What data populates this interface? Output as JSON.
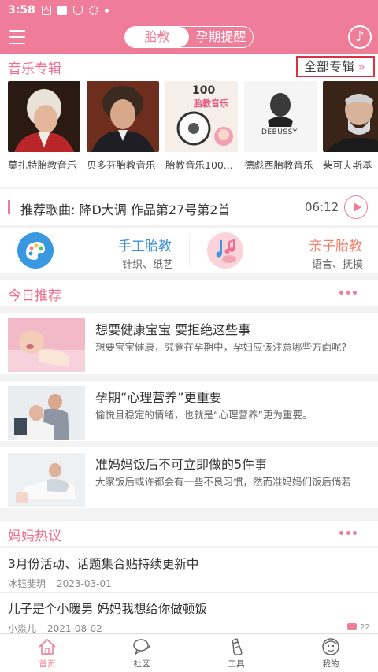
{
  "status_bar": {
    "time": "3:58"
  },
  "header": {
    "tabs": [
      {
        "label": "胎教",
        "active": true
      },
      {
        "label": "孕期提醒",
        "active": false
      }
    ],
    "music_icon": "music-note-icon"
  },
  "albums": {
    "section_title": "音乐专辑",
    "all_label": "全部专辑",
    "items": [
      {
        "caption": "莫扎特胎教音乐"
      },
      {
        "caption": "贝多芬胎教音乐"
      },
      {
        "caption": "胎教音乐100...",
        "cover_text_1": "100",
        "cover_text_2": "胎教音乐"
      },
      {
        "caption": "德彪西胎教音乐",
        "cover_text": "DEBUSSY"
      },
      {
        "caption": "柴可夫斯基"
      }
    ]
  },
  "song": {
    "label": "推荐歌曲:  降D大调 作品第27号第2首",
    "duration": "06:12"
  },
  "categories": [
    {
      "title": "手工胎教",
      "subtitle": "针织、纸艺",
      "color": "#3d8fd6"
    },
    {
      "title": "亲子胎教",
      "subtitle": "语言、抚摸",
      "color": "#ef7d6a"
    }
  ],
  "recommend": {
    "section_title": "今日推荐",
    "articles": [
      {
        "title": "想要健康宝宝 要拒绝这些事",
        "desc": "想要宝宝健康，究竟在孕期中，孕妇应该注意哪些方面呢?"
      },
      {
        "title": "孕期“心理营养”更重要",
        "desc": "愉悦且稳定的情绪，也就是“心理营养”更为重要。"
      },
      {
        "title": "准妈妈饭后不可立即做的5件事",
        "desc": "大家饭后或许都会有一些不良习惯，然而准妈妈们饭后倘若"
      }
    ]
  },
  "hot": {
    "section_title": "妈妈热议",
    "posts": [
      {
        "title": "3月份活动、话题集合贴持续更新中",
        "author": "冰钰斐玥",
        "date": "2023-03-01"
      },
      {
        "title": "儿子是个小暖男 妈妈我想给你做顿饭",
        "author": "小淼儿",
        "date": "2021-08-02",
        "comments": "22"
      }
    ]
  },
  "bottom_nav": [
    {
      "label": "首页",
      "icon": "home-icon",
      "active": true
    },
    {
      "label": "社区",
      "icon": "chat-icon",
      "active": false
    },
    {
      "label": "工具",
      "icon": "bottle-icon",
      "active": false
    },
    {
      "label": "我的",
      "icon": "profile-icon",
      "active": false
    }
  ],
  "colors": {
    "accent": "#ef7d99",
    "section_title": "#ef6d8e",
    "highlight_box": "#e03040"
  }
}
